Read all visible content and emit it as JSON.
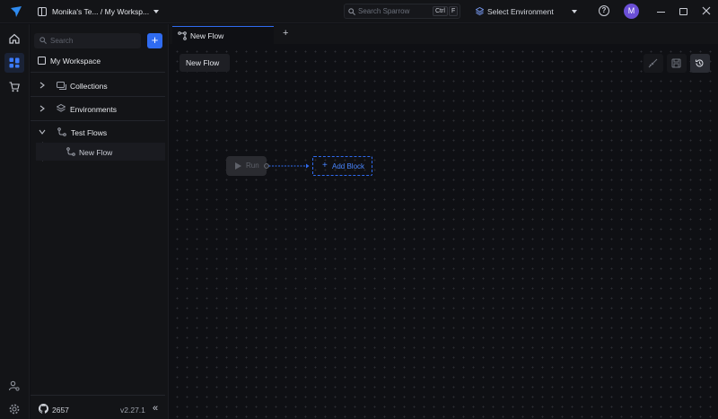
{
  "topbar": {
    "workspace_label": "Monika's Te... / My Worksp...",
    "search_placeholder": "Search Sparrow",
    "shortcut_key1": "Ctrl",
    "shortcut_key2": "F",
    "environment_label": "Select Environment",
    "help_glyph": "?",
    "avatar_initial": "M"
  },
  "sidebar": {
    "search_placeholder": "Search",
    "add_glyph": "+",
    "workspace_title": "My Workspace",
    "items": [
      {
        "label": "Collections"
      },
      {
        "label": "Environments"
      },
      {
        "label": "Test Flows"
      }
    ],
    "flow_item": "New Flow",
    "github_count": "2657",
    "version": "v2.27.1",
    "collapse_glyph": "«"
  },
  "tabs": [
    {
      "label": "New Flow"
    }
  ],
  "tab_add_glyph": "+",
  "canvas": {
    "flow_name": "New Flow",
    "run_label": "Run",
    "add_block_label": "Add Block"
  },
  "colors": {
    "accent": "#2f6bf0",
    "avatar": "#6b4fd6",
    "background": "#0f1014"
  },
  "icons": [
    "sparrow-logo",
    "workspace-icon",
    "search-icon",
    "env-icon",
    "help-icon",
    "home-icon",
    "collections-grid-icon",
    "cart-icon",
    "settings-user-icon",
    "gear-icon",
    "folder-icon",
    "layers-icon",
    "flow-icon",
    "github-icon",
    "broom-icon",
    "save-icon",
    "history-icon",
    "play-icon"
  ]
}
